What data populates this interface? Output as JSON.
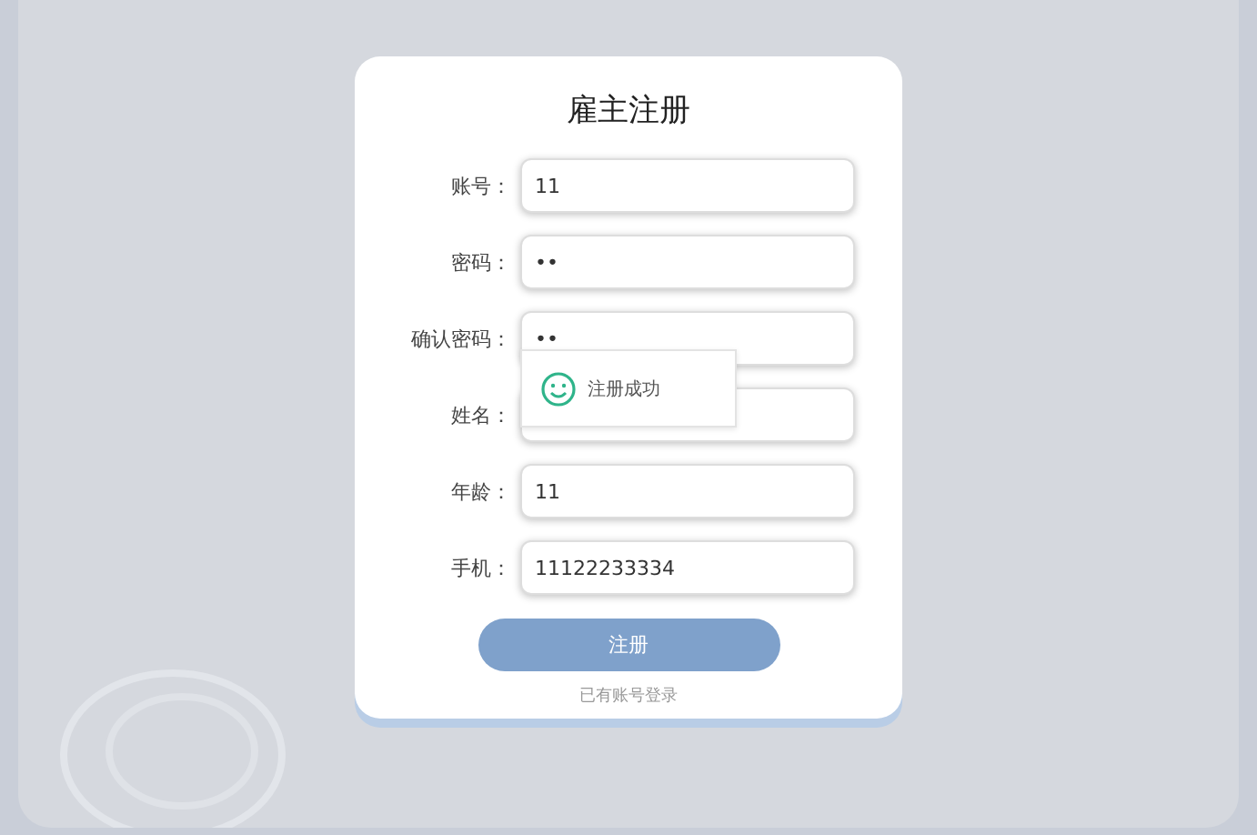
{
  "title": "雇主注册",
  "fields": [
    {
      "label": "账号：",
      "value": "11"
    },
    {
      "label": "密码：",
      "value": "••"
    },
    {
      "label": "确认密码：",
      "value": "••"
    },
    {
      "label": "姓名："
    },
    {
      "label": "年龄：",
      "value": "11"
    },
    {
      "label": "手机：",
      "value": "11122233334"
    }
  ],
  "toast": {
    "message": "注册成功"
  },
  "submit_button": "注册",
  "login_link": "已有账号登录"
}
